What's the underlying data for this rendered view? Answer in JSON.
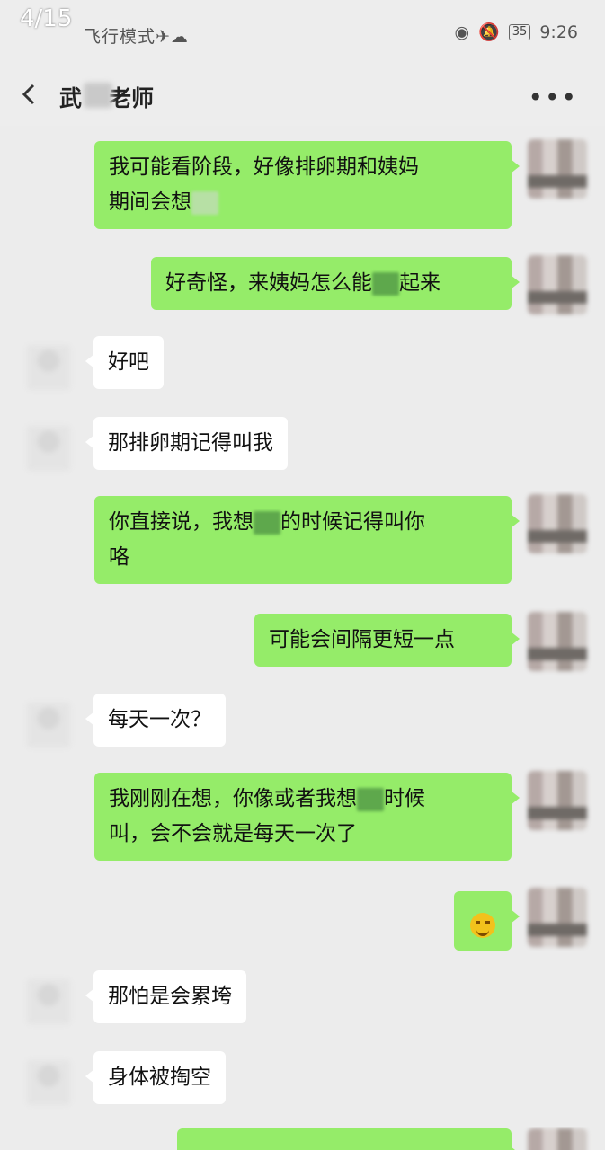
{
  "status_bar": {
    "counter": "4/15",
    "mode": "飞行模式✈☁",
    "battery": "35",
    "time": "9:26"
  },
  "header": {
    "title_pre": "武",
    "title_post": "老师"
  },
  "messages": [
    {
      "from": "me",
      "parts": [
        "我可能看阶段，好像排卵期和姨妈",
        "期间会想"
      ]
    },
    {
      "from": "me",
      "parts": [
        "好奇怪，来姨妈怎么能",
        "起来"
      ]
    },
    {
      "from": "them",
      "text": "好吧"
    },
    {
      "from": "them",
      "text": "那排卵期记得叫我"
    },
    {
      "from": "me",
      "parts": [
        "你直接说，我想",
        "的时候记得叫你",
        "咯"
      ]
    },
    {
      "from": "me",
      "text": "可能会间隔更短一点"
    },
    {
      "from": "them",
      "text": "每天一次？"
    },
    {
      "from": "me",
      "parts": [
        "我刚刚在想，你像或者我想",
        "时候",
        "叫，会不会就是每天一次了"
      ]
    },
    {
      "from": "me",
      "emoji": "laughing-emoji"
    },
    {
      "from": "them",
      "text": "那怕是会累垮"
    },
    {
      "from": "them",
      "text": "身体被掏空"
    }
  ]
}
